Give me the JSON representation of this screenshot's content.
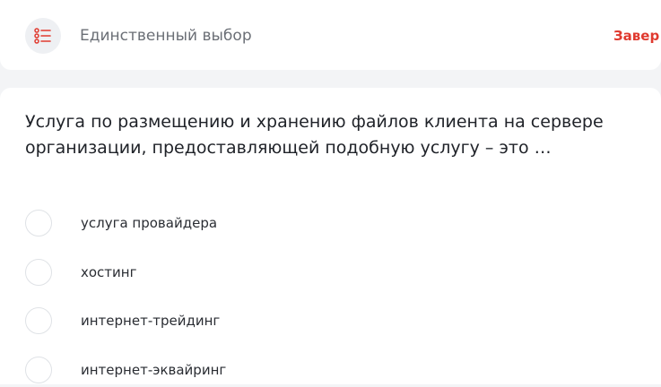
{
  "header": {
    "type_label": "Единственный выбор",
    "finish_label": "Завер"
  },
  "question": {
    "line1": "Услуга по размещению и хранению файлов клиента на сервере",
    "line2": "организации, предоставляющей подобную услугу – это …"
  },
  "options": [
    {
      "label": "услуга провайдера",
      "selected": false
    },
    {
      "label": "хостинг",
      "selected": false
    },
    {
      "label": "интернет-трейдинг",
      "selected": false
    },
    {
      "label": "интернет-эквайринг",
      "selected": false
    }
  ],
  "colors": {
    "accent": "#e03a2f",
    "page_background": "#f3f4f6",
    "card_background": "#ffffff"
  },
  "icons": {
    "question_type": "list-icon"
  }
}
